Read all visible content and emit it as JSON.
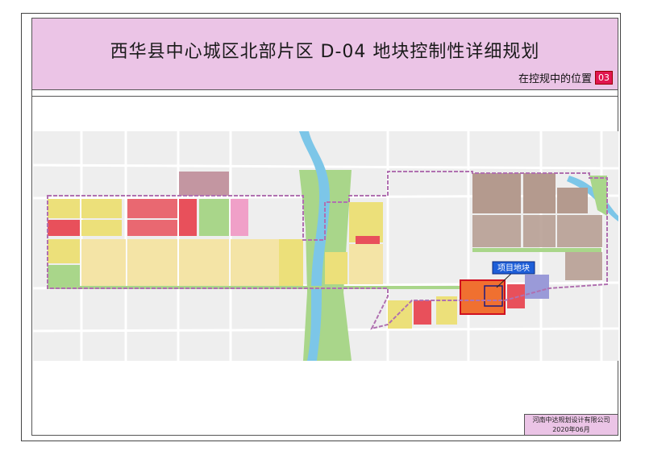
{
  "sheet": {
    "title": "西华县中心城区北部片区 D-04 地块控制性详细规划",
    "subtitle": "在控规中的位置",
    "sheet_number": "03"
  },
  "map": {
    "callout_label": "项目地块",
    "colors": {
      "residential": "#f4e4a6",
      "residential_dark": "#ece07a",
      "commercial": "#e8505b",
      "public": "#f0a0c8",
      "industrial": "#b49a8e",
      "green": "#a9d68a",
      "water": "#7cc6e8",
      "site": "#f07030",
      "boundary": "#b070b0",
      "roads": "#ffffff",
      "background": "#efefef"
    }
  },
  "footer": {
    "company": "河南中达规划设计有限公司",
    "date": "2020年06月"
  }
}
